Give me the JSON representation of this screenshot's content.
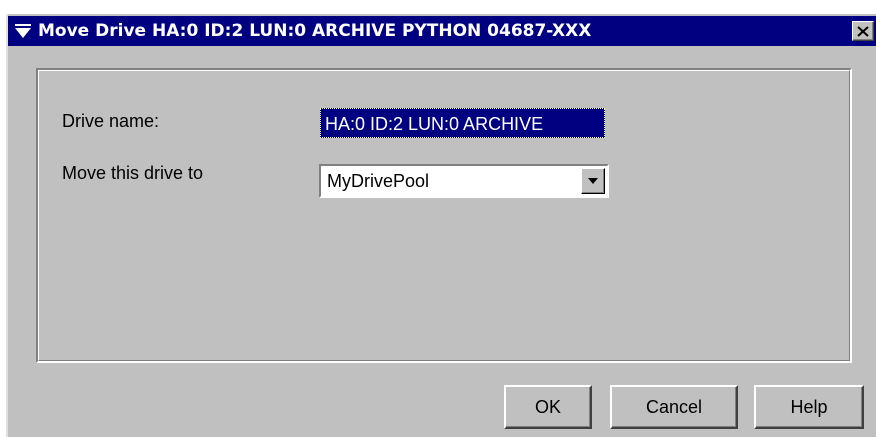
{
  "window": {
    "title": "Move Drive HA:0 ID:2 LUN:0 ARCHIVE PYTHON 04687-XXX",
    "system_menu_icon": "down-triangle-menu-icon",
    "close_icon": "close-x-icon"
  },
  "form": {
    "drive_name_label": "Drive name:",
    "drive_name_value": "HA:0 ID:2 LUN:0 ARCHIVE",
    "move_to_label": "Move this drive to",
    "move_to_selected": "MyDrivePool",
    "dropdown_icon": "chevron-down-icon"
  },
  "buttons": {
    "ok": "OK",
    "cancel": "Cancel",
    "help": "Help"
  },
  "colors": {
    "titlebar": "#000080",
    "dialog_bg": "#c0c0c0",
    "selection_bg": "#000080"
  }
}
